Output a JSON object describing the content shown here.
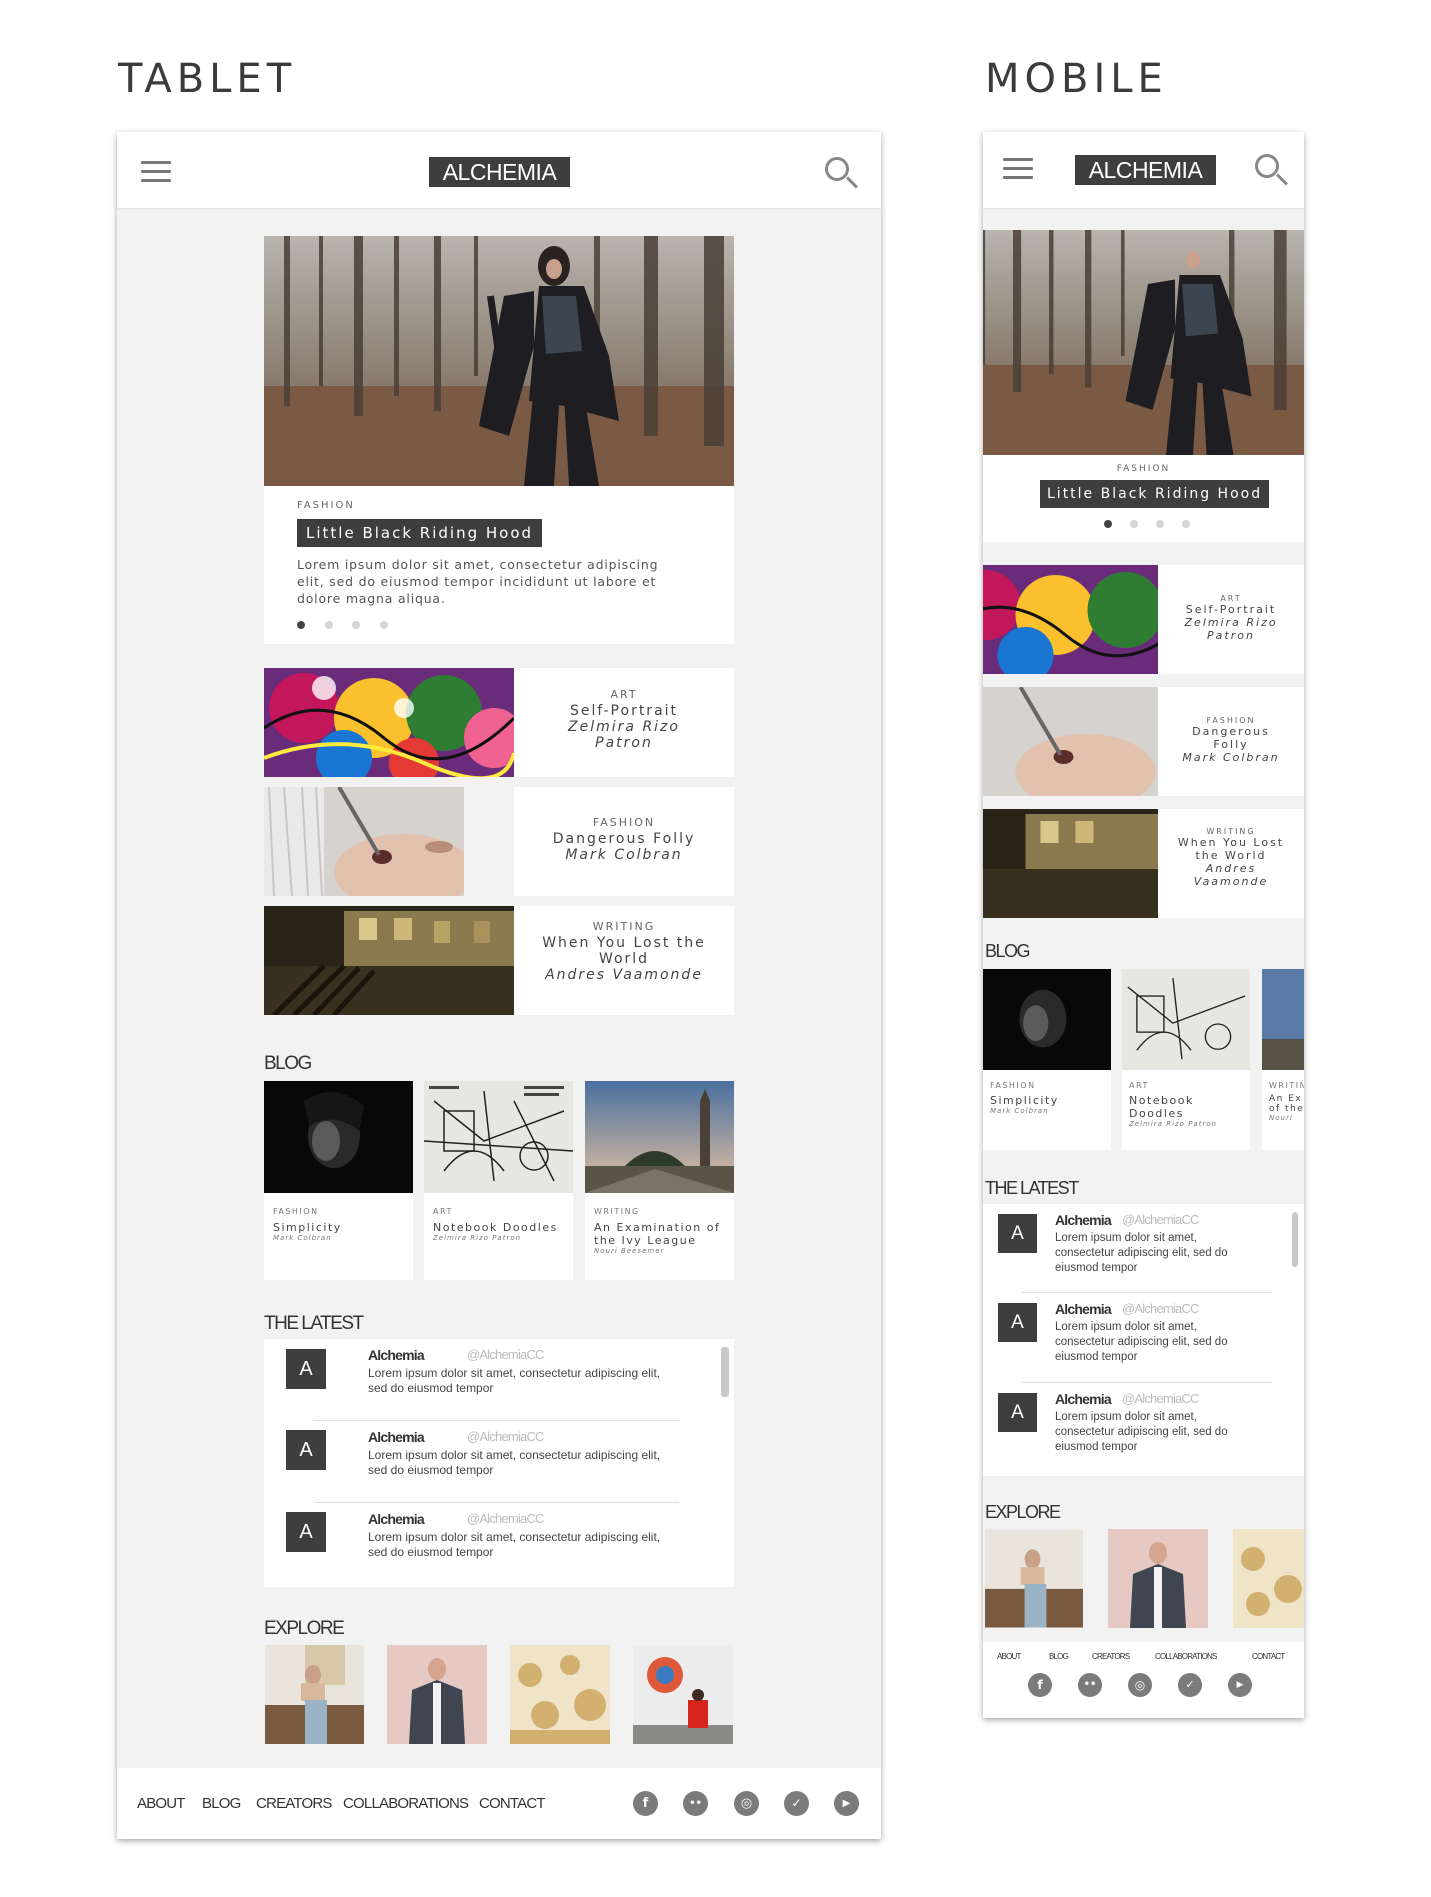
{
  "headings": {
    "tablet": "TABLET",
    "mobile": "MOBILE"
  },
  "header": {
    "logo": "ALCHEMIA",
    "menu_icon": "hamburger-icon",
    "search_icon": "search-icon"
  },
  "hero": {
    "category": "FASHION",
    "title": "Little Black Riding Hood",
    "excerpt_lines": [
      "Lorem ipsum dolor sit amet, consectetur adipiscing",
      "elit, sed do eiusmod tempor incididunt ut labore et",
      "dolore magna aliqua."
    ],
    "dots": 4,
    "active_dot": 0
  },
  "features": [
    {
      "category": "ART",
      "title": "Self-Portrait",
      "author_tablet": [
        "Zelmira Rizo",
        "Patron"
      ],
      "mobile_lines": [
        "Self-Portrait",
        "Zelmira Rizo",
        "Patron"
      ]
    },
    {
      "category": "FASHION",
      "title": "Dangerous Folly",
      "author_tablet": [
        "Mark Colbran"
      ],
      "mobile_lines": [
        "Dangerous",
        "Folly",
        "Mark Colbran"
      ]
    },
    {
      "category": "WRITING",
      "title_tablet": [
        "When You Lost the",
        "World"
      ],
      "author_tablet": [
        "Andres Vaamonde"
      ],
      "mobile_lines": [
        "When You Lost",
        "the World",
        "Andres",
        "Vaamonde"
      ]
    }
  ],
  "blog": {
    "title": "BLOG",
    "posts": [
      {
        "category": "FASHION",
        "title": "Simplicity",
        "author": "Mark Colbran"
      },
      {
        "category": "ART",
        "title": "Notebook Doodles",
        "mobile_title": [
          "Notebook",
          "Doodles"
        ],
        "author": "Zelmira Rizo Patron"
      },
      {
        "category": "WRITING",
        "title": "An Examination of the Ivy League",
        "title_lines": [
          "An Examination of",
          "the Ivy League"
        ],
        "author": "Nouri Beesemer"
      }
    ],
    "mobile_third": {
      "category": "WRITIN",
      "title_lines": [
        "An Ex",
        "of the"
      ],
      "author": "Nouri"
    }
  },
  "latest": {
    "title": "THE LATEST",
    "tweets": [
      {
        "avatar": "A",
        "name": "Alchemia",
        "handle": "@AlchemiaCC",
        "tablet_lines": [
          "Lorem ipsum dolor sit amet, consectetur adipiscing elit,",
          "sed do eiusmod tempor"
        ],
        "mobile_lines": [
          "Lorem ipsum dolor sit amet,",
          "consectetur adipiscing elit, sed do",
          "eiusmod tempor"
        ]
      },
      {
        "avatar": "A",
        "name": "Alchemia",
        "handle": "@AlchemiaCC",
        "tablet_lines": [
          "Lorem ipsum dolor sit amet, consectetur adipiscing elit,",
          "sed do eiusmod tempor"
        ],
        "mobile_lines": [
          "Lorem ipsum dolor sit amet,",
          "consectetur adipiscing elit, sed do",
          "eiusmod tempor"
        ]
      },
      {
        "avatar": "A",
        "name": "Alchemia",
        "handle": "@AlchemiaCC",
        "tablet_lines": [
          "Lorem ipsum dolor sit amet, consectetur adipiscing elit,",
          "sed do eiusmod tempor"
        ],
        "mobile_lines": [
          "Lorem ipsum dolor sit amet,",
          "consectetur adipiscing elit, sed do",
          "eiusmod tempor"
        ]
      }
    ]
  },
  "explore": {
    "title": "EXPLORE"
  },
  "footer": {
    "links": [
      "ABOUT",
      "BLOG",
      "CREATORS",
      "COLLABORATIONS",
      "CONTACT"
    ],
    "social": [
      {
        "icon": "facebook-icon",
        "glyph": "f"
      },
      {
        "icon": "flickr-icon",
        "glyph": "••"
      },
      {
        "icon": "instagram-icon",
        "glyph": "◎"
      },
      {
        "icon": "twitter-icon",
        "glyph": "✓"
      },
      {
        "icon": "youtube-icon",
        "glyph": "▶"
      }
    ]
  },
  "colors": {
    "dark": "#3e3e3e",
    "panel": "#f2f2f2",
    "social": "#7b7b7b"
  }
}
